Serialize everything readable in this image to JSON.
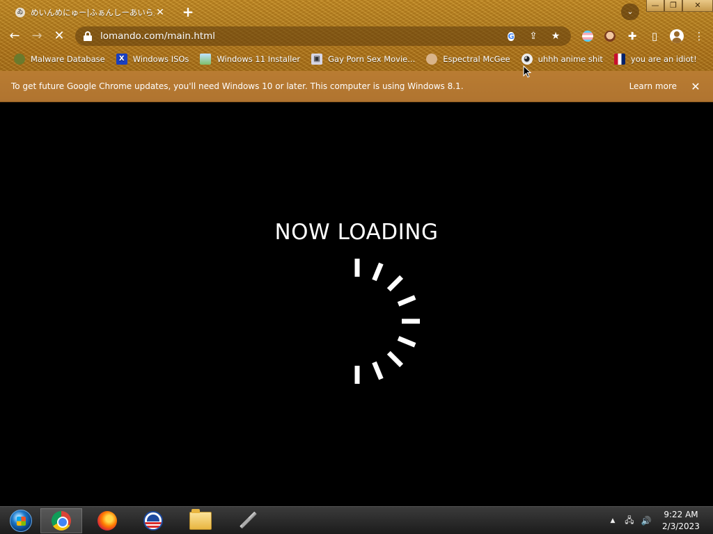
{
  "browser": {
    "tab": {
      "favicon": "ゐ",
      "title": "めいんめにゅー|ふぁんしーあいらんど",
      "close": "✕"
    },
    "new_tab": "+",
    "tab_search": "⌄",
    "window_controls": {
      "minimize": "—",
      "restore": "❐",
      "close": "✕"
    },
    "nav": {
      "back": "←",
      "forward": "→",
      "stop": "✕"
    },
    "url": "lomando.com/main.html",
    "omnibox_icons": {
      "google": "G",
      "share": "⇪",
      "star": "★"
    },
    "toolbar_icons": {
      "extensions": "✚",
      "sidepanel": "▯",
      "menu": "⋮"
    },
    "bookmarks": [
      {
        "label": "Malware Database",
        "icon": "malware-icon",
        "glyph": ""
      },
      {
        "label": "Windows ISOs",
        "icon": "x-icon",
        "glyph": "X"
      },
      {
        "label": "Windows 11 Installer",
        "icon": "installer-icon",
        "glyph": ""
      },
      {
        "label": "Gay Porn Sex Movie...",
        "icon": "monitor-icon",
        "glyph": "▣"
      },
      {
        "label": "Espectral McGee",
        "icon": "character-icon",
        "glyph": ""
      },
      {
        "label": "uhhh anime shit",
        "icon": "anime-icon",
        "glyph": "◕"
      },
      {
        "label": "you are an idiot!",
        "icon": "flag-icon",
        "glyph": ""
      }
    ],
    "infobar": {
      "text": "To get future Google Chrome updates, you'll need Windows 10 or later. This computer is using Windows 8.1.",
      "learn_more": "Learn more",
      "close": "✕"
    }
  },
  "page": {
    "heading": "NOW LOADING"
  },
  "taskbar": {
    "tray": {
      "arrow": "▲",
      "network": "🖧",
      "volume": "🔊"
    },
    "time": "9:22 AM",
    "date": "2/3/2023"
  },
  "colors": {
    "theme_gold": "#b8801e",
    "infobar": "#b97c32",
    "page_bg": "#000000",
    "spinner": "#ffffff"
  }
}
